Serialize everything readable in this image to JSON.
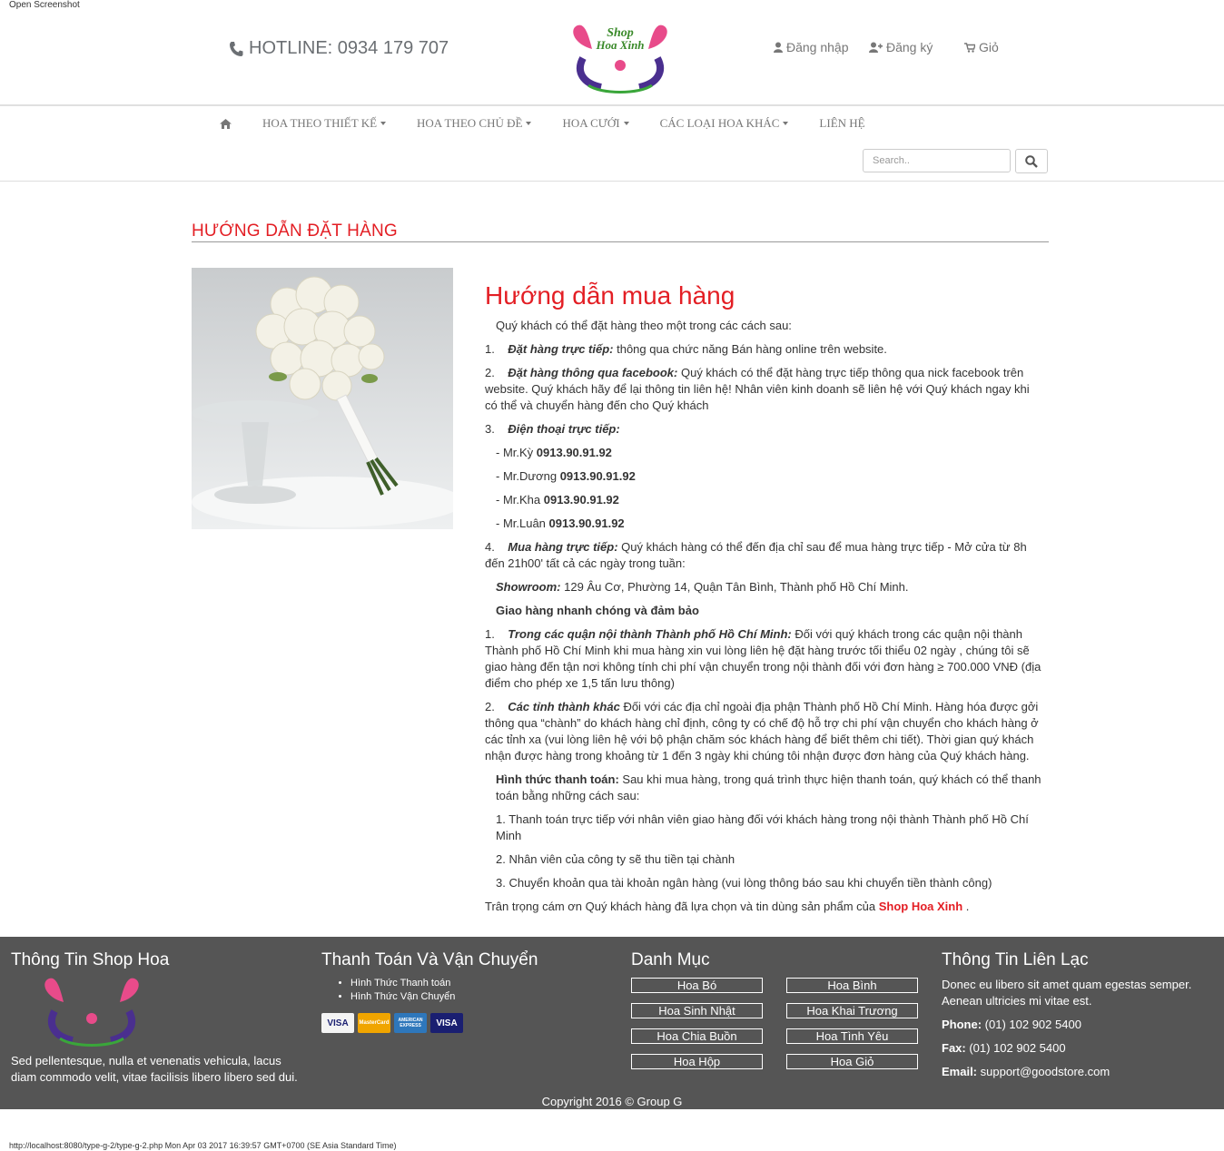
{
  "top_note": "Open Screenshot",
  "header": {
    "hotline": "HOTLINE: 0934 179 707",
    "logo_text_line1": "Shop",
    "logo_text_line2": "Hoa Xinh",
    "login": "Đăng nhập",
    "register": "Đăng ký",
    "cart": "Giỏ"
  },
  "nav": {
    "items": [
      {
        "label": "HOA THEO THIẾT KẾ"
      },
      {
        "label": "HOA THEO CHỦ ĐỀ"
      },
      {
        "label": "HOA CƯỚI"
      },
      {
        "label": "CÁC LOẠI HOA KHÁC"
      },
      {
        "label": "LIÊN HỆ"
      }
    ],
    "search_placeholder": "Search.."
  },
  "section_title": "HƯỚNG DẪN ĐẶT HÀNG",
  "content": {
    "heading": "Hướng dẫn mua hàng",
    "intro": "Quý khách có thể đặt hàng theo một trong các cách sau:",
    "m1_num": "1.",
    "m1_title": "Đặt hàng trực tiếp:",
    "m1_text": " thông qua chức năng Bán hàng online trên website.",
    "m2_num": "2.",
    "m2_title": "Đặt hàng thông qua facebook:",
    "m2_text": " Quý khách có thể đặt hàng trực tiếp thông qua nick facebook trên website. Quý khách hãy để lại thông tin liên hệ! Nhân viên kinh doanh sẽ liên hệ với Quý khách ngay khi có thể và chuyển hàng đến cho Quý khách",
    "m3_num": "3.",
    "m3_title": "Điện thoại trực tiếp:",
    "phones": [
      {
        "name": "- Mr.Kỳ ",
        "number": "0913.90.91.92"
      },
      {
        "name": "- Mr.Dương ",
        "number": "0913.90.91.92"
      },
      {
        "name": "- Mr.Kha ",
        "number": "0913.90.91.92"
      },
      {
        "name": "- Mr.Luân ",
        "number": "0913.90.91.92"
      }
    ],
    "m4_num": "4.",
    "m4_title": "Mua hàng trực tiếp:",
    "m4_text": " Quý khách hàng có thể đến địa chỉ sau để mua hàng trực tiếp - Mở cửa từ 8h đến 21h00' tất cả các ngày trong tuần:",
    "showroom_label": "Showroom:",
    "showroom_text": " 129 Âu Cơ, Phường 14, Quận Tân Bình, Thành phố Hồ Chí Minh.",
    "delivery_heading": "Giao hàng nhanh chóng và đảm bảo",
    "d1_num": "1.",
    "d1_title": "Trong các quận nội thành Thành phố Hồ Chí Minh:",
    "d1_text": " Đối với quý khách trong các quận nội thành Thành phố Hồ Chí Minh khi mua hàng xin vui lòng liên hệ đặt hàng trước tối thiểu 02 ngày , chúng tôi sẽ giao hàng đến tận nơi không tính chi phí vận chuyển trong nội thành đối với đơn hàng ≥ 700.000 VNĐ (địa điểm cho phép xe 1,5 tấn lưu thông)",
    "d2_num": "2.",
    "d2_title": "Các tỉnh thành khác",
    "d2_text": " Đối với các địa chỉ ngoài địa phận Thành phố Hồ Chí Minh. Hàng hóa được gởi thông qua “chành” do khách hàng chỉ định, công ty có chế độ hỗ trợ chi phí vận chuyển cho khách hàng ở các tỉnh xa (vui lòng liên hệ với bộ phận chăm sóc khách hàng để biết thêm chi tiết). Thời gian quý khách nhận được hàng trong khoảng từ 1 đến 3 ngày khi chúng tôi nhận được đơn hàng của Quý khách hàng.",
    "payment_label": "Hình thức thanh toán:",
    "payment_text": " Sau khi mua hàng, trong quá trình thực hiện thanh toán, quý khách có thể thanh toán bằng những cách sau:",
    "p1": "1.   Thanh toán trực tiếp với nhân viên giao hàng đối với khách hàng trong nội thành Thành phố Hồ Chí Minh",
    "p2": "2.   Nhân viên của công ty sẽ thu tiền tại chành",
    "p3": "3.   Chuyển khoản qua tài khoản ngân hàng (vui lòng thông báo sau khi chuyển tiền thành công)",
    "thanks_text": "Trân trọng cám ơn Quý khách hàng đã lựa chọn và tin dùng sản phẩm của ",
    "thanks_brand": "Shop Hoa Xinh",
    "thanks_end": " ."
  },
  "footer": {
    "col1_title": "Thông Tin Shop Hoa",
    "col1_text": "Sed pellentesque, nulla et venenatis vehicula, lacus diam commodo velit, vitae facilisis libero libero sed dui.",
    "col2_title": "Thanh Toán Và Vận Chuyển",
    "col2_links": [
      "Hình Thức Thanh toán",
      "Hình Thức Vận Chuyển"
    ],
    "cards": [
      "VISA",
      "MasterCard",
      "AMERICAN EXPRESS",
      "VISA"
    ],
    "col3_title": "Danh Mục",
    "categories": [
      "Hoa Bó",
      "Hoa Bình",
      "Hoa Sinh Nhật",
      "Hoa Khai Trương",
      "Hoa Chia Buồn",
      "Hoa Tình Yêu",
      "Hoa Hộp",
      "Hoa Giỏ"
    ],
    "col4_title": "Thông Tin Liên Lạc",
    "col4_text": "Donec eu libero sit amet quam egestas semper. Aenean ultricies mi vitae est.",
    "phone_label": "Phone:",
    "phone": " (01) 102 902 5400",
    "fax_label": "Fax:",
    "fax": " (01) 102 902 5400",
    "email_label": "Email:",
    "email": " support@goodstore.com",
    "copyright": "Copyright 2016 © Group G"
  },
  "bottom_url": "http://localhost:8080/type-g-2/type-g-2.php Mon Apr 03 2017 16:39:57 GMT+0700 (SE Asia Standard Time)",
  "colors": {
    "accent": "#e31e24",
    "footer_bg": "#555555"
  }
}
